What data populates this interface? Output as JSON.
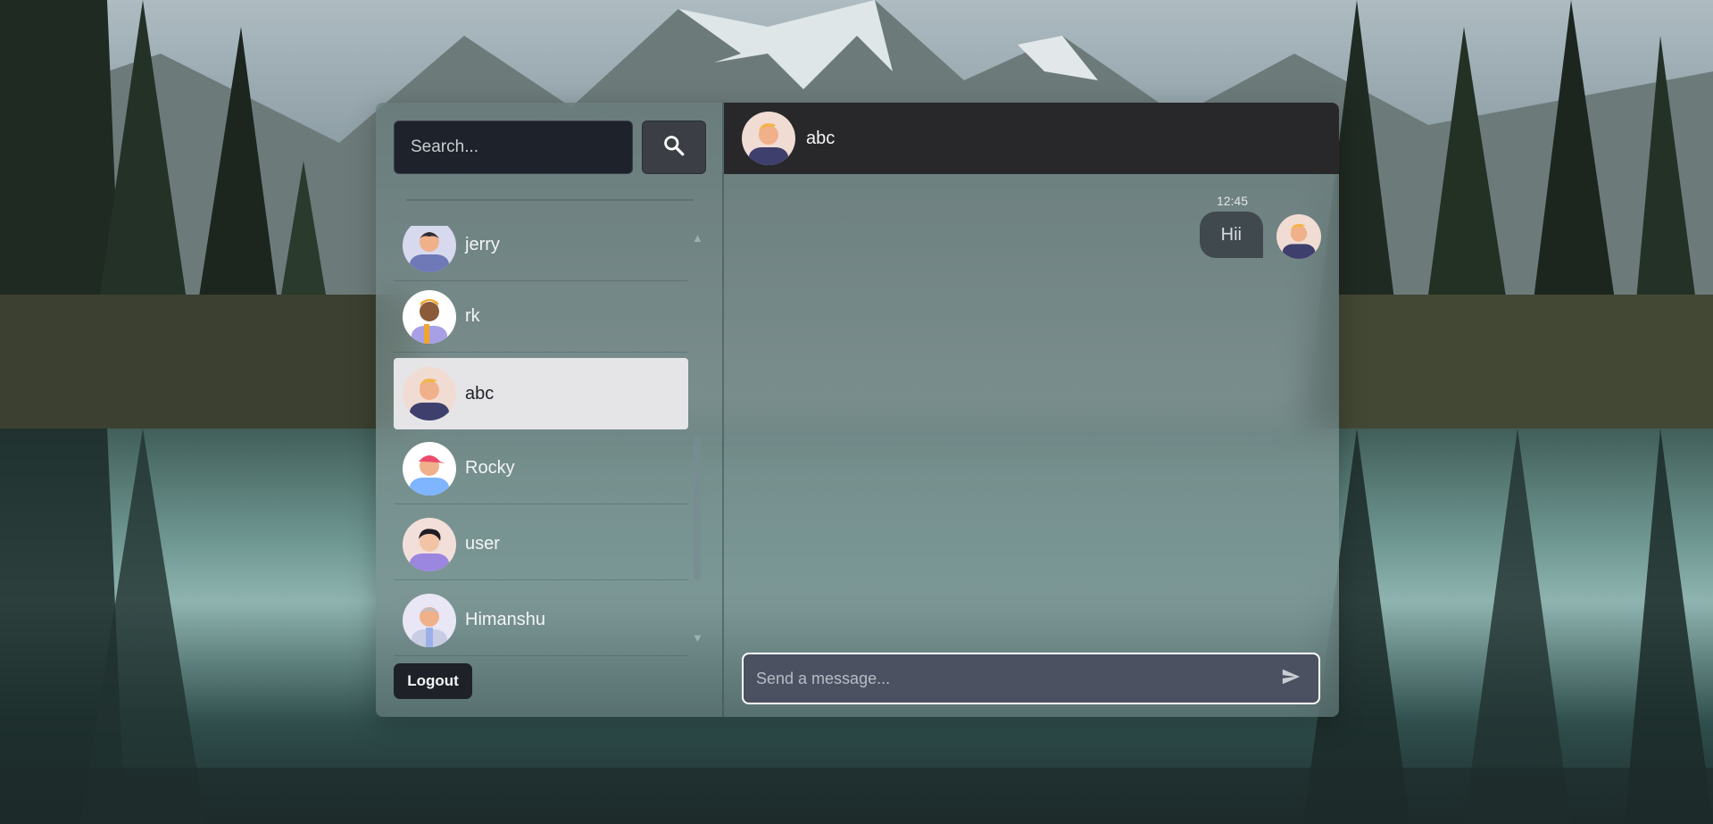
{
  "search": {
    "placeholder": "Search..."
  },
  "users": [
    {
      "name": "jerry",
      "avatar": "jerry-avatar",
      "active": false
    },
    {
      "name": "rk",
      "avatar": "rk-avatar",
      "active": false
    },
    {
      "name": "abc",
      "avatar": "abc-avatar",
      "active": true
    },
    {
      "name": "Rocky",
      "avatar": "rocky-avatar",
      "active": false
    },
    {
      "name": "user",
      "avatar": "user-avatar",
      "active": false
    },
    {
      "name": "Himanshu",
      "avatar": "himanshu-avatar",
      "active": false
    }
  ],
  "logout_label": "Logout",
  "chat": {
    "title": "abc",
    "messages": [
      {
        "time": "12:45",
        "text": "Hii"
      }
    ],
    "composer_placeholder": "Send a message..."
  },
  "colors": {
    "header_bg": "#28282b",
    "active_item_bg": "#e5e5e7",
    "search_bg": "#1e222a",
    "composer_bg": "#4b5161"
  }
}
